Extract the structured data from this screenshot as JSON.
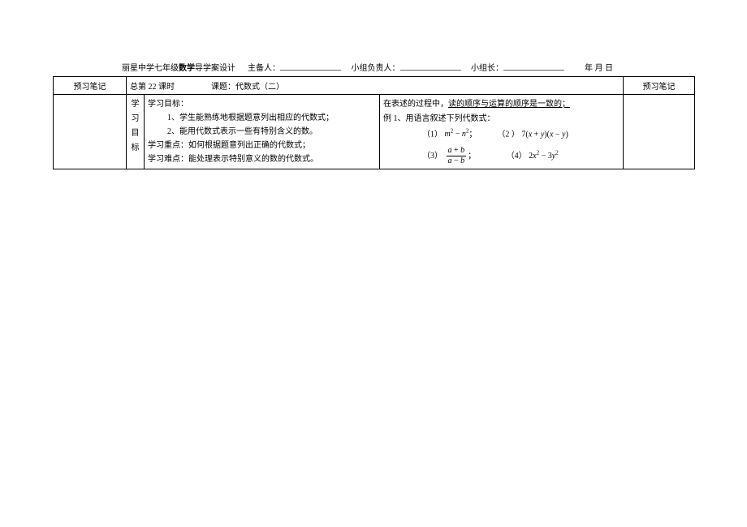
{
  "header": {
    "school": "丽星中学七年级",
    "subject_bold": "数学",
    "design": "导学案设计",
    "prepared_by": "主备人：",
    "group_leader": "小组负责人：",
    "team_leader": "小组长：",
    "date": "年  月  日"
  },
  "row1": {
    "left_note": "预习笔记",
    "lesson_no": "总第 22 课时",
    "topic_label": "课题：代数式（二）",
    "right_note": "预习笔记"
  },
  "goals": {
    "side_label_1": "学",
    "side_label_2": "习",
    "side_label_3": "目",
    "side_label_4": "标",
    "title": "学习目标：",
    "item1": "1、学生能熟练地根据题意列出相应的代数式；",
    "item2": "2、能用代数式表示一些有特别含义的数。",
    "focus": "学习重点：如何根据题意列出正确的代数式；",
    "difficulty": "学习难点：能处理表示特别意义的数的代数式。"
  },
  "right": {
    "line1a": "在表述的过程中，",
    "line1b": "读的顺序与运算的顺序是一致的；",
    "example_label": "例 1、用语言叙述下列代数式：",
    "eq1_label": "（1）",
    "eq1_sep": "；",
    "eq2_label": "（2 ）",
    "eq3_label": "（3）",
    "eq3_sep": "；",
    "eq4_label": "（4）"
  },
  "math": {
    "m": "m",
    "n": "n",
    "a": "a",
    "b": "b",
    "x": "x",
    "y": "y",
    "seven": "7",
    "two": "2",
    "three": "3",
    "minus": "−",
    "plus": "+",
    "lp": "(",
    "rp": ")"
  }
}
